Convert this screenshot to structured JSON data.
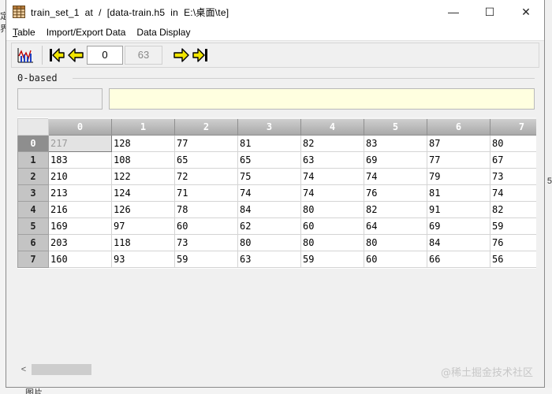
{
  "window": {
    "title": "train_set_1  at  /  [data-train.h5  in  E:\\桌面\\te]",
    "minimize_glyph": "—",
    "maximize_glyph": "☐",
    "close_glyph": "✕"
  },
  "background": {
    "left_top": "定",
    "left_mid": "界",
    "right_mid": "5",
    "bottom_text": "图片"
  },
  "menu": {
    "table_first": "T",
    "table_rest": "able",
    "import_first": "I",
    "import_rest": "mport/Export Data",
    "display_first": "D",
    "display_rest": "ata Display"
  },
  "toolbar": {
    "page_value": "0",
    "page_total": "63"
  },
  "index_label": "0-based",
  "grid": {
    "columns": [
      "0",
      "1",
      "2",
      "3",
      "4",
      "5",
      "6",
      "7"
    ],
    "rows": [
      {
        "label": "0",
        "cells": [
          "217",
          "128",
          "77",
          "81",
          "82",
          "83",
          "87",
          "80"
        ]
      },
      {
        "label": "1",
        "cells": [
          "183",
          "108",
          "65",
          "65",
          "63",
          "69",
          "77",
          "67"
        ]
      },
      {
        "label": "2",
        "cells": [
          "210",
          "122",
          "72",
          "75",
          "74",
          "74",
          "79",
          "73"
        ]
      },
      {
        "label": "3",
        "cells": [
          "213",
          "124",
          "71",
          "74",
          "74",
          "76",
          "81",
          "74"
        ]
      },
      {
        "label": "4",
        "cells": [
          "216",
          "126",
          "78",
          "84",
          "80",
          "82",
          "91",
          "82"
        ]
      },
      {
        "label": "5",
        "cells": [
          "169",
          "97",
          "60",
          "62",
          "60",
          "64",
          "69",
          "59"
        ]
      },
      {
        "label": "6",
        "cells": [
          "203",
          "118",
          "73",
          "80",
          "80",
          "80",
          "84",
          "76"
        ]
      },
      {
        "label": "7",
        "cells": [
          "160",
          "93",
          "59",
          "63",
          "59",
          "60",
          "66",
          "56"
        ]
      }
    ]
  },
  "scrollbar": {
    "left_glyph": "<"
  },
  "watermark": "@稀土掘金技术社区",
  "colors": {
    "arrow_fill": "#f2e600",
    "arrow_stroke": "#000000",
    "cell_value_bg": "#ffffe0"
  }
}
